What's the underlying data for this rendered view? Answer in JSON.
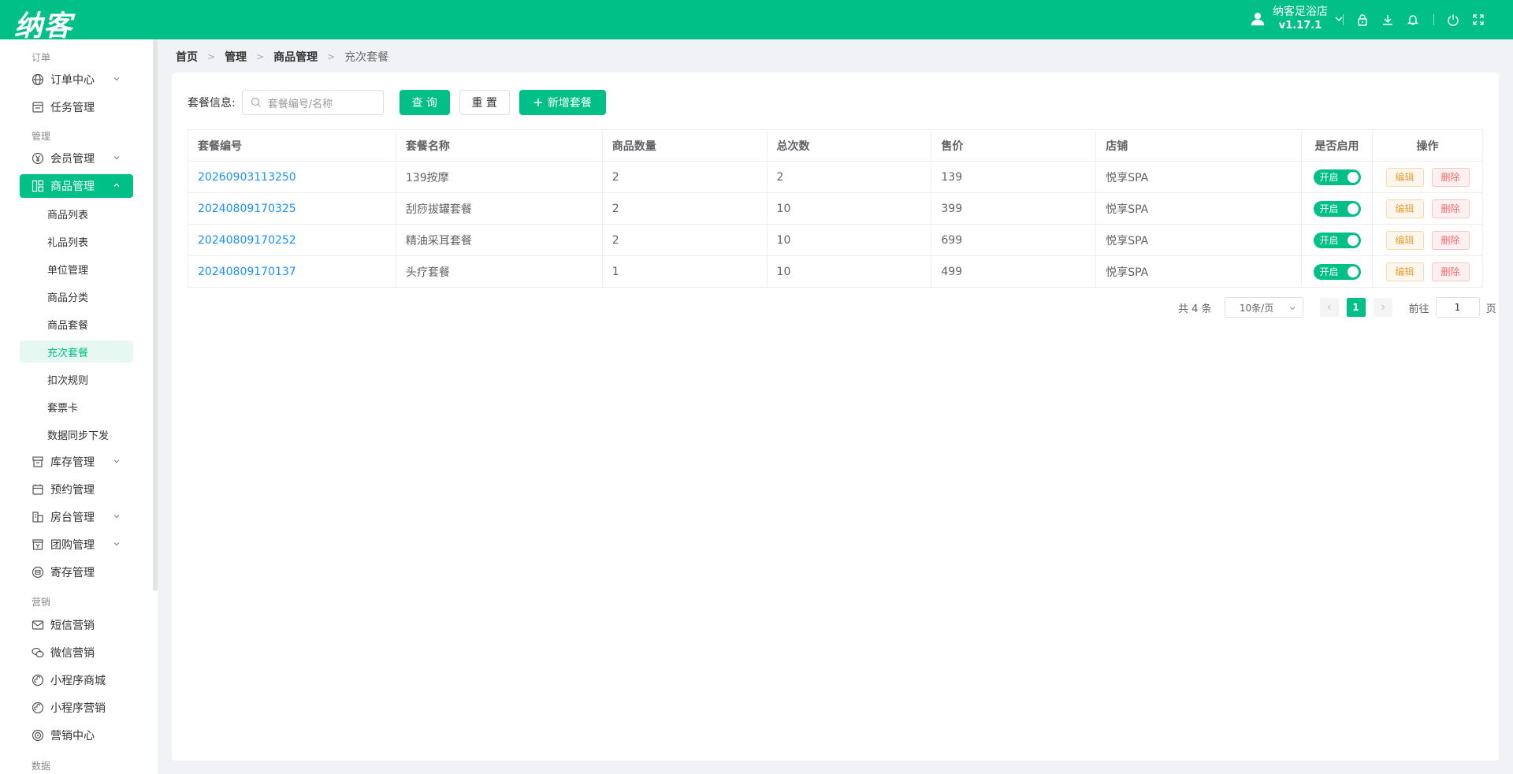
{
  "app": {
    "logo": "纳客",
    "store_name": "纳客足浴店",
    "version": "v1.17.1"
  },
  "topbar_icons": [
    "lock-icon",
    "download-icon",
    "bell-icon",
    "power-icon",
    "fullscreen-icon"
  ],
  "sidebar": {
    "groups": {
      "order": "订单",
      "manage": "管理",
      "marketing": "营销",
      "data": "数据"
    },
    "items": {
      "order_center": "订单中心",
      "task_manage": "任务管理",
      "member_manage": "会员管理",
      "goods_manage": "商品管理",
      "stock_manage": "库存管理",
      "booking_manage": "预约管理",
      "room_manage": "房台管理",
      "group_buy": "团购管理",
      "deposit_manage": "寄存管理",
      "sms_marketing": "短信营销",
      "wechat_marketing": "微信营销",
      "miniapp_mall": "小程序商城",
      "miniapp_marketing": "小程序营销",
      "marketing_center": "营销中心"
    },
    "sub_items": {
      "goods_list": "商品列表",
      "gift_list": "礼品列表",
      "unit_manage": "单位管理",
      "goods_category": "商品分类",
      "goods_package": "商品套餐",
      "recharge_package": "充次套餐",
      "deduct_rule": "扣次规则",
      "ticket_card": "套票卡",
      "data_sync": "数据同步下发"
    }
  },
  "breadcrumb": [
    "首页",
    "管理",
    "商品管理",
    "充次套餐"
  ],
  "search": {
    "label": "套餐信息:",
    "placeholder": "套餐编号/名称",
    "query_btn": "查 询",
    "reset_btn": "重 置",
    "add_btn": "新增套餐"
  },
  "table": {
    "headers": [
      "套餐编号",
      "套餐名称",
      "商品数量",
      "总次数",
      "售价",
      "店铺",
      "是否启用",
      "操作"
    ],
    "rows": [
      {
        "code": "20260903113250",
        "name": "139按摩",
        "qty": "2",
        "times": "2",
        "price": "139",
        "store": "悦享SPA",
        "enabled": "开启"
      },
      {
        "code": "20240809170325",
        "name": "刮痧拔罐套餐",
        "qty": "2",
        "times": "10",
        "price": "399",
        "store": "悦享SPA",
        "enabled": "开启"
      },
      {
        "code": "20240809170252",
        "name": "精油采耳套餐",
        "qty": "2",
        "times": "10",
        "price": "699",
        "store": "悦享SPA",
        "enabled": "开启"
      },
      {
        "code": "20240809170137",
        "name": "头疗套餐",
        "qty": "1",
        "times": "10",
        "price": "499",
        "store": "悦享SPA",
        "enabled": "开启"
      }
    ],
    "edit_label": "编辑",
    "delete_label": "删除"
  },
  "pagination": {
    "total": "共 4 条",
    "page_size": "10条/页",
    "current_page": "1",
    "goto_label": "前往",
    "goto_value": "1",
    "page_suffix": "页"
  },
  "colors": {
    "primary": "#00bf87",
    "link": "#1890ff",
    "edit": "#e6a23c",
    "delete": "#f56c6c"
  }
}
